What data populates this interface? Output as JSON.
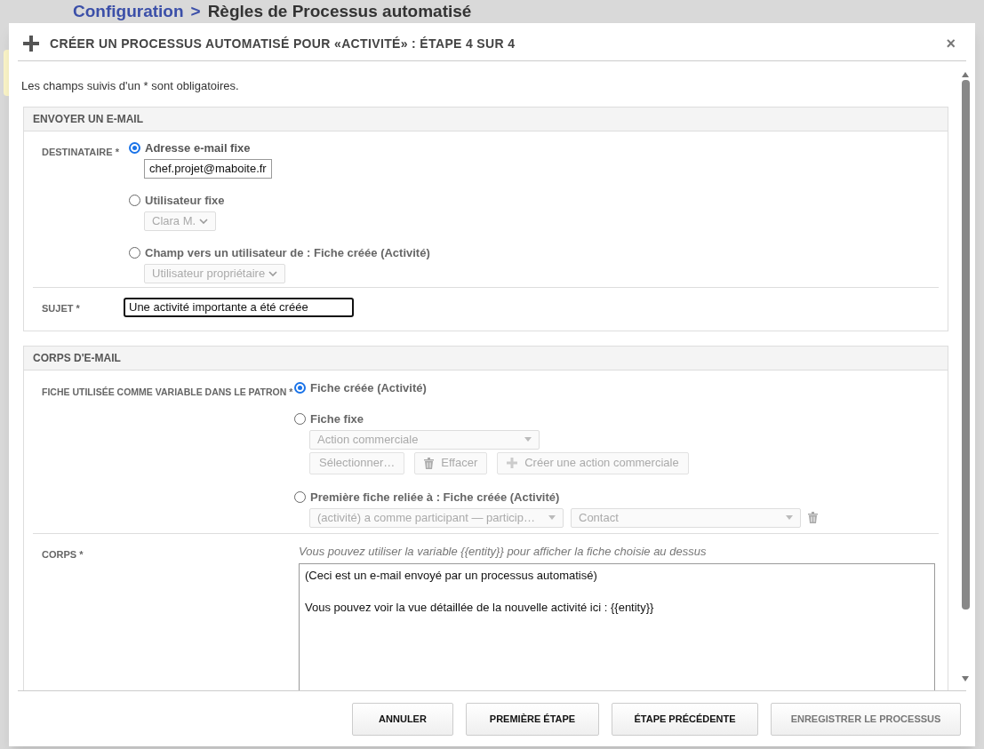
{
  "background_page": {
    "breadcrumb": "Configuration",
    "separator": ">",
    "title": "Règles de Processus automatisé"
  },
  "dialog": {
    "title": "CRÉER UN PROCESSUS AUTOMATISÉ POUR «ACTIVITÉ» : ÉTAPE 4 SUR 4",
    "close": "×",
    "required_note": "Les champs suivis d'un * sont obligatoires."
  },
  "send_email": {
    "heading": "ENVOYER UN E-MAIL",
    "recipient_label": "DESTINATAIRE *",
    "recipient_options": [
      {
        "label": "Adresse e-mail fixe",
        "selected": true,
        "kind": "input",
        "value": "chef.projet@maboite.fr"
      },
      {
        "label": "Utilisateur fixe",
        "selected": false,
        "kind": "select",
        "value": "Clara M."
      },
      {
        "label": "Champ vers un utilisateur de : Fiche créée (Activité)",
        "selected": false,
        "kind": "select",
        "value": "Utilisateur propriétaire"
      }
    ],
    "subject_label": "SUJET *",
    "subject_value": "Une activité importante a été créée"
  },
  "email_body": {
    "heading": "CORPS D'E-MAIL",
    "entity_label": "FICHE UTILISÉE COMME VARIABLE DANS LE PATRON *",
    "entity_options": [
      {
        "label": "Fiche créée (Activité)",
        "selected": true,
        "kind": "plain"
      },
      {
        "label": "Fiche fixe",
        "selected": false,
        "kind": "fixed",
        "select": "Action commerciale",
        "buttons": [
          "Sélectionner…",
          "Effacer",
          "Créer une action commerciale"
        ]
      },
      {
        "label": "Première fiche reliée à : Fiche créée (Activité)",
        "selected": false,
        "kind": "related",
        "selects": [
          "(activité) a comme participant — particip…",
          "Contact"
        ]
      }
    ],
    "body_label": "CORPS *",
    "body_hint": "Vous pouvez utiliser la variable {{entity}} pour afficher la fiche choisie au dessus",
    "body_value": "(Ceci est un e-mail envoyé par un processus automatisé)\n\nVous pouvez voir la vue détaillée de la nouvelle activité ici : {{entity}}"
  },
  "footer_buttons": [
    {
      "label": "ANNULER",
      "disabled": false
    },
    {
      "label": "PREMIÈRE ÉTAPE",
      "disabled": false
    },
    {
      "label": "ÉTAPE PRÉCÉDENTE",
      "disabled": false
    },
    {
      "label": "ENREGISTRER LE PROCESSUS",
      "disabled": true
    }
  ]
}
